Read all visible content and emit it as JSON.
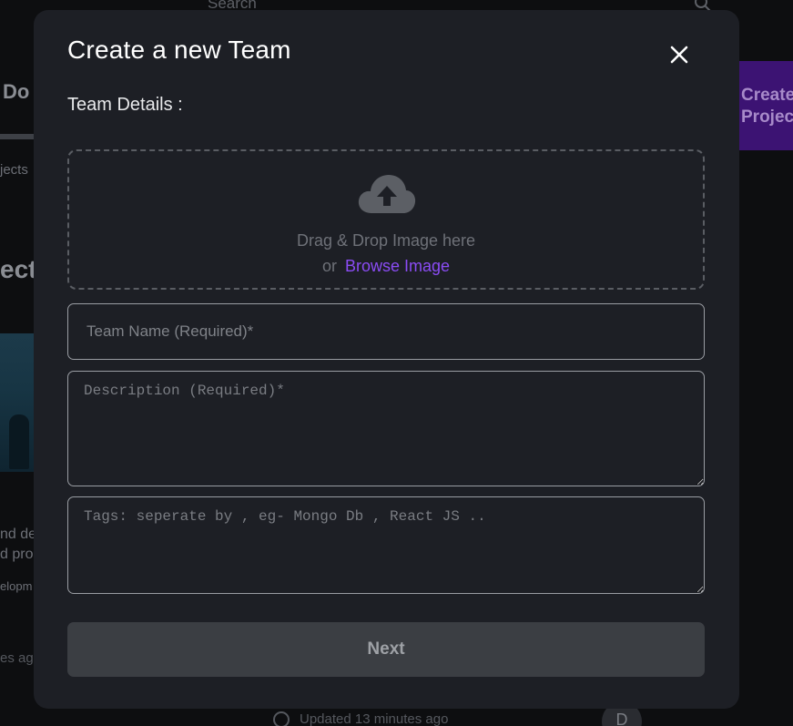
{
  "background": {
    "search_placeholder": "Search",
    "nav_label": "Do",
    "sub_label": "jects",
    "section_title": "ect",
    "description_line_1": "nd de",
    "description_line_2": "d pro",
    "tag": "elopm",
    "updated_left": "es ag",
    "create_button": "Create Project",
    "updated_bottom": "Updated 13 minutes ago",
    "avatar_initial": "D"
  },
  "modal": {
    "title": "Create a new Team",
    "section_label": "Team Details :",
    "dropzone": {
      "text": "Drag & Drop Image here",
      "or": "or",
      "browse_label": "Browse Image"
    },
    "fields": {
      "team_name_placeholder": "Team Name (Required)*",
      "description_placeholder": "Description (Required)*",
      "tags_placeholder": "Tags: seperate by , eg- Mongo Db , React JS .."
    },
    "next_label": "Next"
  },
  "icons": {
    "close": "close-icon",
    "upload": "cloud-upload-icon",
    "search": "search-icon",
    "clock": "clock-icon"
  },
  "colors": {
    "modal_bg": "#1d1f25",
    "accent": "#8b4cf5",
    "next_bg": "#3b3e43",
    "create_btn": "#3c1373"
  }
}
